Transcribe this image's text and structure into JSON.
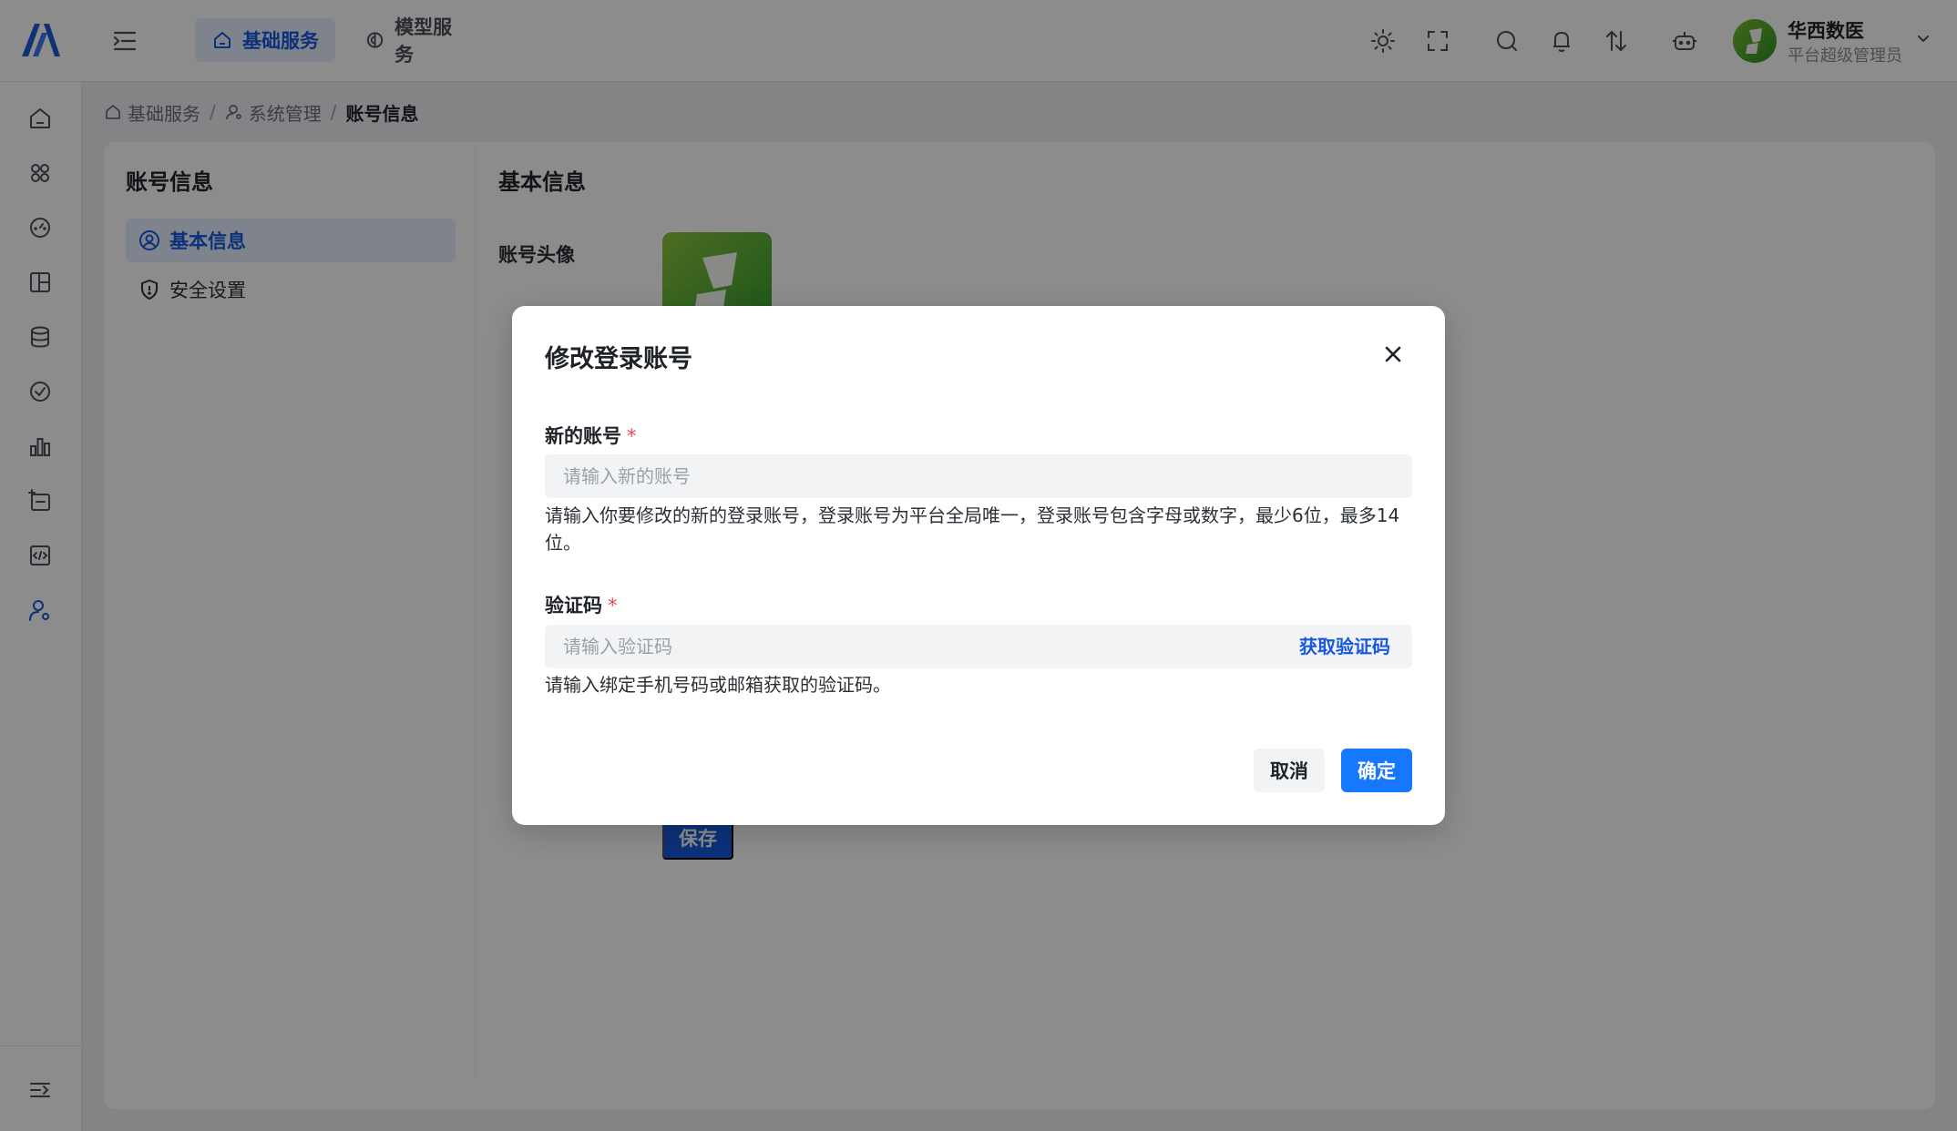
{
  "topbar": {
    "tabs": [
      {
        "label": "基础服务",
        "icon": "home-icon",
        "active": true
      },
      {
        "label": "模型服务",
        "icon": "brain-icon",
        "active": false
      }
    ],
    "icons": [
      "sun-icon",
      "fullscreen-icon",
      "search-icon",
      "bell-icon",
      "transfer-icon",
      "robot-icon"
    ],
    "user": {
      "name": "华西数医",
      "role": "平台超级管理员"
    }
  },
  "rail": {
    "icons": [
      "home-icon",
      "apps-icon",
      "dashboard-icon",
      "layout-icon",
      "database-icon",
      "check-circle-icon",
      "bar-chart-icon",
      "task-icon",
      "code-icon",
      "user-settings-icon",
      "collapse-icon"
    ]
  },
  "breadcrumb": {
    "items": [
      "基础服务",
      "系统管理",
      "账号信息"
    ],
    "separator": "/"
  },
  "side": {
    "title": "账号信息",
    "items": [
      {
        "label": "基本信息",
        "active": true
      },
      {
        "label": "安全设置",
        "active": false
      }
    ]
  },
  "content": {
    "title": "基本信息",
    "avatar_label": "账号头像",
    "save_label": "保存"
  },
  "dialog": {
    "title": "修改登录账号",
    "account": {
      "label": "新的账号",
      "required_mark": "*",
      "placeholder": "请输入新的账号",
      "value": "",
      "help": "请输入你要修改的新的登录账号，登录账号为平台全局唯一，登录账号包含字母或数字，最少6位，最多14位。"
    },
    "code": {
      "label": "验证码",
      "required_mark": "*",
      "placeholder": "请输入验证码",
      "value": "",
      "get_code_label": "获取验证码",
      "help": "请输入绑定手机号码或邮箱获取的验证码。"
    },
    "cancel_label": "取消",
    "ok_label": "确定"
  },
  "colors": {
    "primary": "#1677ff",
    "active_text": "#1659e0",
    "active_bg": "#e8f0ff",
    "required": "#e5484d"
  }
}
